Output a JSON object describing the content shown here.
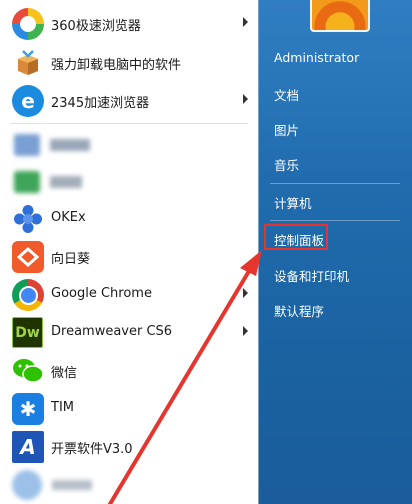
{
  "colors": {
    "accent_red": "#e5352d",
    "panel_bg": "#ffffff",
    "glass_text": "#ffffff"
  },
  "left_items": [
    {
      "key": "360",
      "label": "360极速浏览器",
      "icon": "360-browser-icon",
      "submenu": true
    },
    {
      "key": "uninstall",
      "label": "强力卸载电脑中的软件",
      "icon": "uninstaller-box-icon",
      "submenu": false
    },
    {
      "key": "2345",
      "label": "2345加速浏览器",
      "icon": "2345-browser-icon",
      "submenu": true
    },
    {
      "key": "okex",
      "label": "OKEx",
      "icon": "okex-icon",
      "submenu": false
    },
    {
      "key": "sunlogin",
      "label": "向日葵",
      "icon": "sunlogin-icon",
      "submenu": false
    },
    {
      "key": "chrome",
      "label": "Google Chrome",
      "icon": "chrome-icon",
      "submenu": true
    },
    {
      "key": "dw",
      "label": "Dreamweaver CS6",
      "icon": "dreamweaver-icon",
      "submenu": true
    },
    {
      "key": "wechat",
      "label": "微信",
      "icon": "wechat-icon",
      "submenu": false
    },
    {
      "key": "tim",
      "label": "TIM",
      "icon": "tim-icon",
      "submenu": false
    },
    {
      "key": "invoice",
      "label": "开票软件V3.0",
      "icon": "invoice-software-icon",
      "submenu": false
    }
  ],
  "right_items": {
    "user": "Administrator",
    "documents": "文档",
    "pictures": "图片",
    "music": "音乐",
    "computer": "计算机",
    "control_panel": "控制面板",
    "devices_printers": "设备和打印机",
    "default_programs": "默认程序"
  }
}
